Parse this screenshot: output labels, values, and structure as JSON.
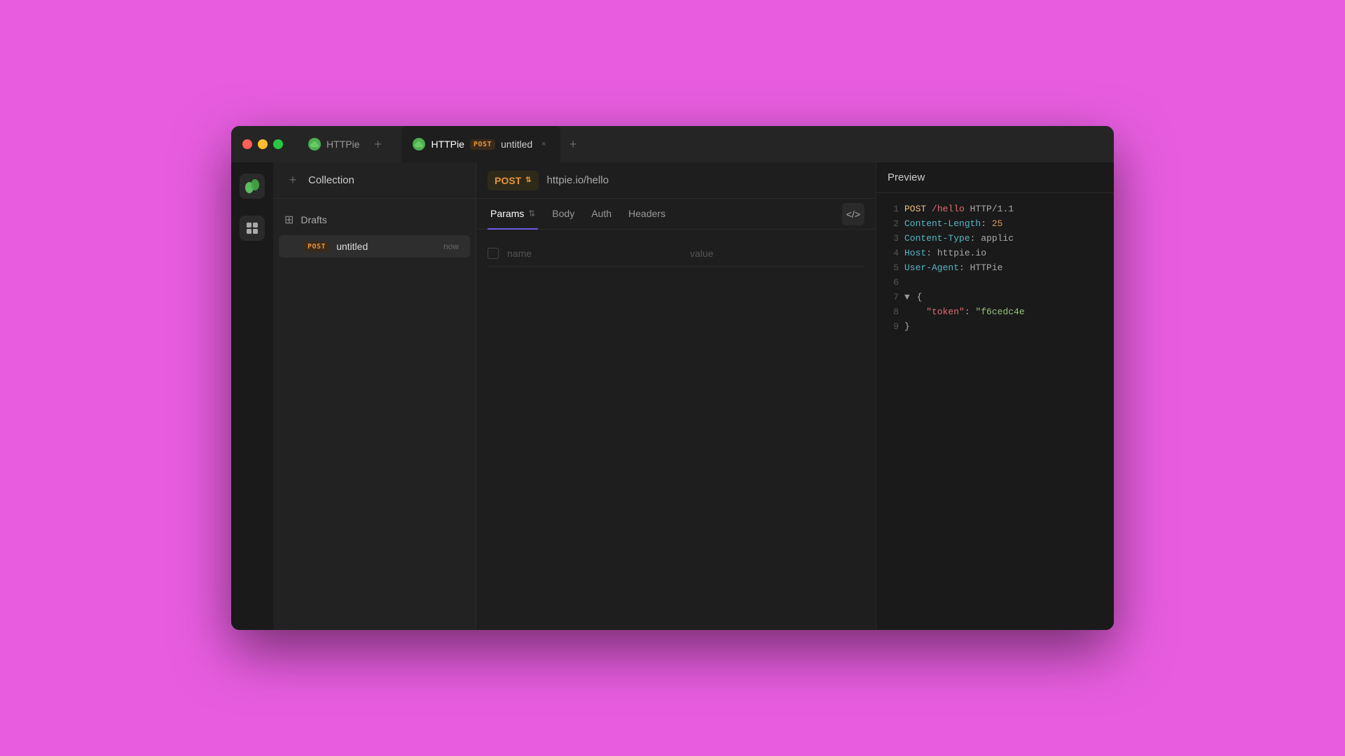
{
  "window": {
    "title": "HTTPie"
  },
  "tabs": [
    {
      "id": "tab1",
      "icon": "cloud-icon",
      "label": "HTTPie",
      "active": false
    },
    {
      "id": "tab2",
      "icon": "cloud-icon",
      "label": "HTTPie",
      "active": true,
      "request_label": "POST",
      "request_name": "untitled"
    }
  ],
  "sidebar": {
    "logo_icon": "httpie-logo-icon",
    "nav_items": [
      {
        "id": "collections-nav",
        "icon": "grid-icon",
        "active": true
      }
    ]
  },
  "collections": {
    "add_label": "+",
    "title": "Collection",
    "drafts_label": "Drafts",
    "requests": [
      {
        "method": "POST",
        "name": "untitled",
        "time": "now"
      }
    ]
  },
  "url_bar": {
    "method": "POST",
    "url": "httpie.io/hello"
  },
  "request_tabs": [
    {
      "id": "params-tab",
      "label": "Params",
      "active": true
    },
    {
      "id": "body-tab",
      "label": "Body",
      "active": false
    },
    {
      "id": "auth-tab",
      "label": "Auth",
      "active": false
    },
    {
      "id": "headers-tab",
      "label": "Headers",
      "active": false
    }
  ],
  "params": {
    "name_placeholder": "name",
    "value_placeholder": "value"
  },
  "preview": {
    "title": "Preview",
    "lines": [
      {
        "num": "1",
        "content": "POST /hello HTTP/1.1"
      },
      {
        "num": "2",
        "content": "Content-Length: 25"
      },
      {
        "num": "3",
        "content": "Content-Type: applic"
      },
      {
        "num": "4",
        "content": "Host: httpie.io"
      },
      {
        "num": "5",
        "content": "User-Agent: HTTPie"
      },
      {
        "num": "6",
        "content": ""
      },
      {
        "num": "7",
        "content": "{"
      },
      {
        "num": "8",
        "content": "  \"token\": \"f6cedc4e"
      },
      {
        "num": "9",
        "content": "}"
      }
    ]
  }
}
